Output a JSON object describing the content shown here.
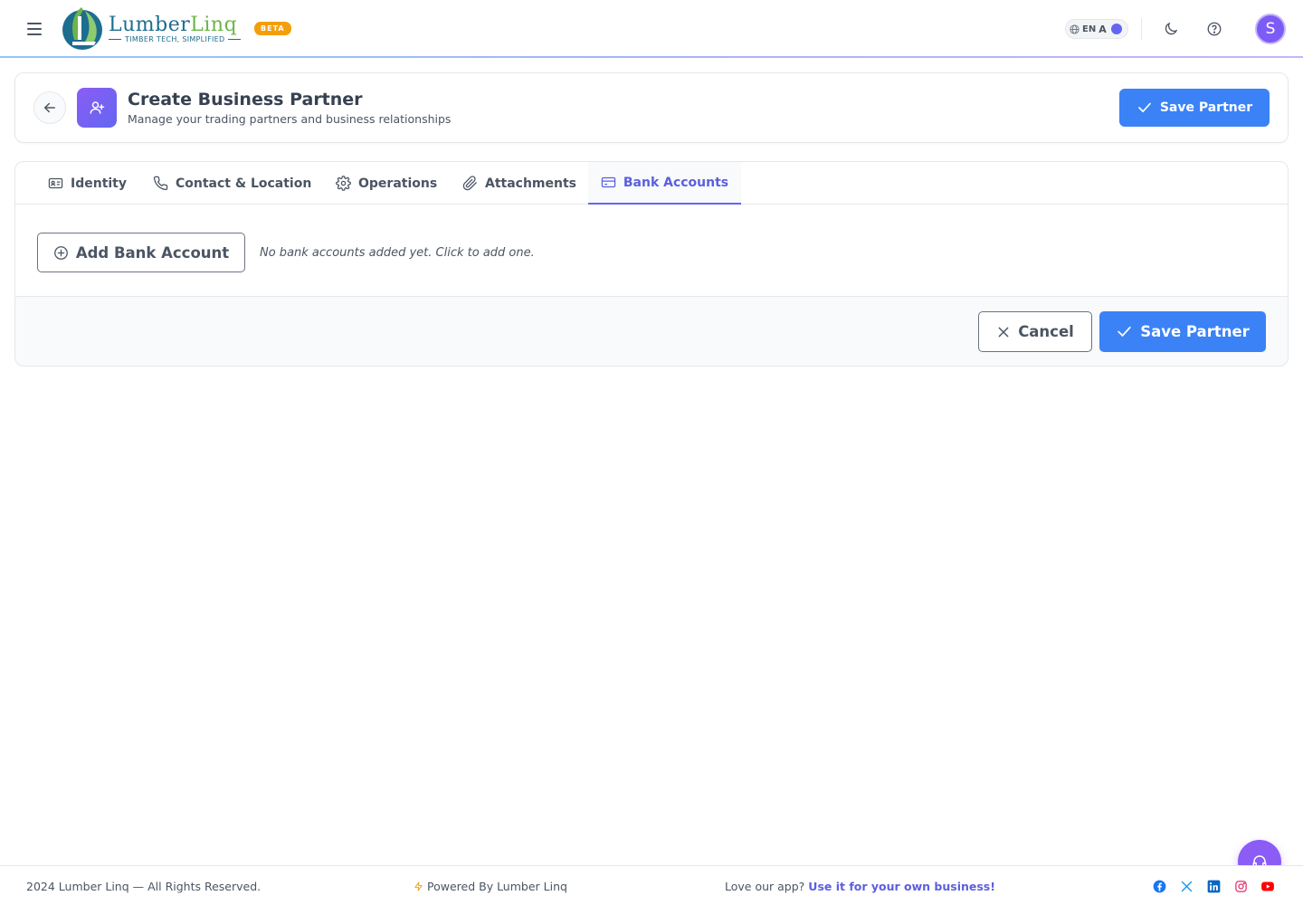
{
  "app": {
    "logo_name_part1": "Lumber",
    "logo_name_part2": "Linq",
    "logo_tagline": "TIMBER TECH, SIMPLIFIED",
    "beta_badge": "BETA",
    "language": "EN",
    "language_alt": "A",
    "avatar_initial": "S"
  },
  "header": {
    "title": "Create Business Partner",
    "subtitle": "Manage your trading partners and business relationships",
    "save_label": "Save Partner"
  },
  "tabs": [
    {
      "label": "Identity",
      "icon": "id-card-icon",
      "active": false
    },
    {
      "label": "Contact & Location",
      "icon": "phone-icon",
      "active": false
    },
    {
      "label": "Operations",
      "icon": "gear-icon",
      "active": false
    },
    {
      "label": "Attachments",
      "icon": "paperclip-icon",
      "active": false
    },
    {
      "label": "Bank Accounts",
      "icon": "credit-card-icon",
      "active": true
    }
  ],
  "bank_accounts": {
    "add_label": "Add Bank Account",
    "empty_message": "No bank accounts added yet. Click to add one."
  },
  "actions": {
    "cancel_label": "Cancel",
    "save_label": "Save Partner"
  },
  "footer": {
    "copyright": "2024 Lumber Linq — All Rights Reserved.",
    "powered_by": "Powered By Lumber Linq",
    "love_text": "Love our app?",
    "love_link": "Use it for your own business!",
    "socials": [
      "facebook-icon",
      "x-icon",
      "linkedin-icon",
      "instagram-icon",
      "youtube-icon"
    ]
  },
  "colors": {
    "primary": "#3b82f6",
    "accent": "#6366f1",
    "brand_blue": "#1d6d8f",
    "brand_green": "#6cb54a",
    "beta": "#f59e0b"
  }
}
